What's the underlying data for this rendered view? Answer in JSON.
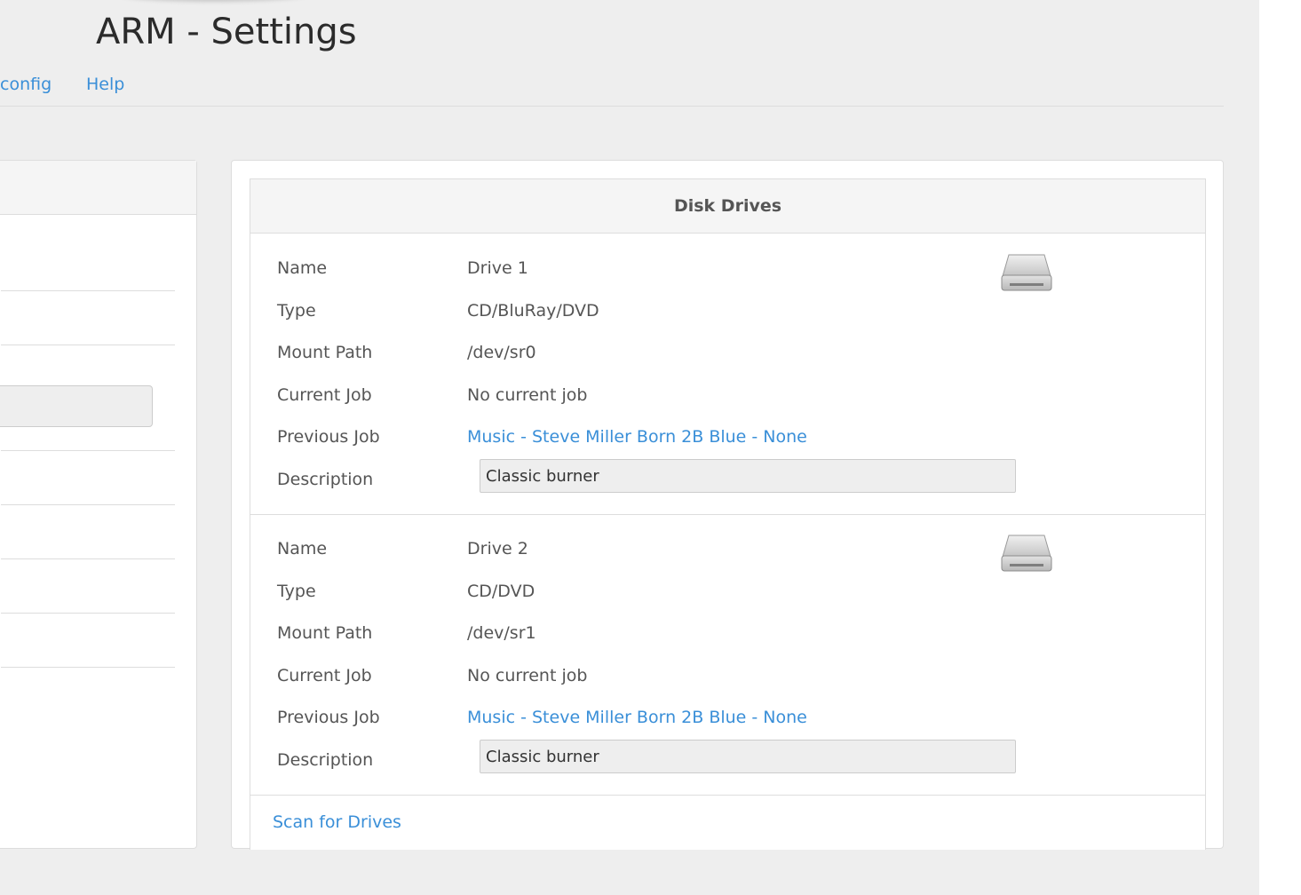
{
  "page": {
    "title": "ARM - Settings"
  },
  "nav": {
    "items": [
      {
        "label": "config"
      },
      {
        "label": "Help"
      }
    ]
  },
  "disk_drives": {
    "heading": "Disk Drives",
    "labels": {
      "name": "Name",
      "type": "Type",
      "mount_path": "Mount Path",
      "current_job": "Current Job",
      "previous_job": "Previous Job",
      "description": "Description"
    },
    "drives": [
      {
        "name": "Drive 1",
        "type": "CD/BluRay/DVD",
        "mount_path": "/dev/sr0",
        "current_job": "No current job",
        "previous_job": "Music - Steve Miller Born 2B Blue - None",
        "description": "Classic burner",
        "icon": "optical-drive-icon"
      },
      {
        "name": "Drive 2",
        "type": "CD/DVD",
        "mount_path": "/dev/sr1",
        "current_job": "No current job",
        "previous_job": "Music - Steve Miller Born 2B Blue - None",
        "description": "Classic burner",
        "icon": "optical-drive-icon"
      }
    ],
    "scan_label": "Scan for Drives"
  },
  "colors": {
    "link": "#3a8fd8",
    "page_background": "#eeeeee",
    "panel_header": "#f5f5f5",
    "border": "#dddddd"
  }
}
